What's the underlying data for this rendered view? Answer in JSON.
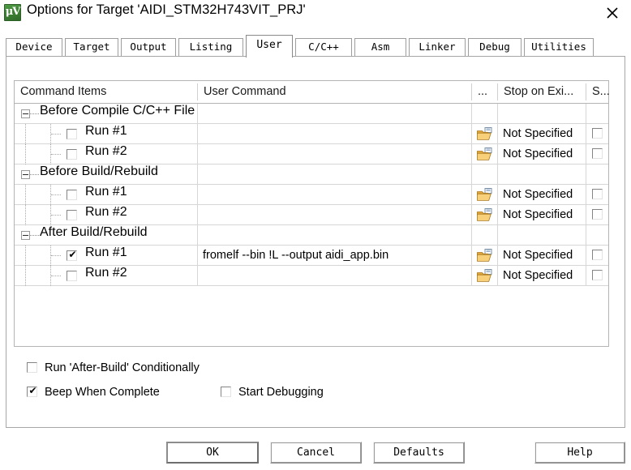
{
  "window": {
    "title": "Options for Target 'AIDI_STM32H743VIT_PRJ'",
    "icon": "uvision-icon",
    "icon_glyph": "μV",
    "close_label": "✕"
  },
  "tabs": [
    {
      "label": "Device",
      "active": false
    },
    {
      "label": "Target",
      "active": false
    },
    {
      "label": "Output",
      "active": false
    },
    {
      "label": "Listing",
      "active": false
    },
    {
      "label": "User",
      "active": true
    },
    {
      "label": "C/C++",
      "active": false
    },
    {
      "label": "Asm",
      "active": false
    },
    {
      "label": "Linker",
      "active": false
    },
    {
      "label": "Debug",
      "active": false
    },
    {
      "label": "Utilities",
      "active": false
    }
  ],
  "grid": {
    "columns": [
      {
        "key": "items",
        "label": "Command Items"
      },
      {
        "key": "command",
        "label": "User Command"
      },
      {
        "key": "browse",
        "label": "..."
      },
      {
        "key": "stop",
        "label": "Stop on Exi..."
      },
      {
        "key": "s",
        "label": "S..."
      }
    ],
    "rows": [
      {
        "type": "group",
        "label": "Before Compile C/C++ File",
        "expanded": true
      },
      {
        "type": "child",
        "label": "Run #1",
        "checked": false,
        "command": "",
        "stop": "Not Specified",
        "s_checked": false
      },
      {
        "type": "child",
        "label": "Run #2",
        "checked": false,
        "command": "",
        "stop": "Not Specified",
        "s_checked": false
      },
      {
        "type": "group",
        "label": "Before Build/Rebuild",
        "expanded": true
      },
      {
        "type": "child",
        "label": "Run #1",
        "checked": false,
        "command": "",
        "stop": "Not Specified",
        "s_checked": false
      },
      {
        "type": "child",
        "label": "Run #2",
        "checked": false,
        "command": "",
        "stop": "Not Specified",
        "s_checked": false
      },
      {
        "type": "group",
        "label": "After Build/Rebuild",
        "expanded": true
      },
      {
        "type": "child",
        "label": "Run #1",
        "checked": true,
        "command": "fromelf --bin !L --output aidi_app.bin",
        "stop": "Not Specified",
        "s_checked": false
      },
      {
        "type": "child",
        "label": "Run #2",
        "checked": false,
        "command": "",
        "stop": "Not Specified",
        "s_checked": false
      }
    ]
  },
  "options": [
    {
      "label": "Run 'After-Build' Conditionally",
      "checked": false
    },
    {
      "label": "Beep When Complete",
      "checked": true
    },
    {
      "label": "Start Debugging",
      "checked": false
    }
  ],
  "footer": {
    "ok": "OK",
    "cancel": "Cancel",
    "defaults": "Defaults",
    "help": "Help"
  },
  "colors": {
    "folder_icon": "#f2c14a",
    "accent_green": "#3c7f33",
    "grid_line": "#d6d6d6"
  }
}
